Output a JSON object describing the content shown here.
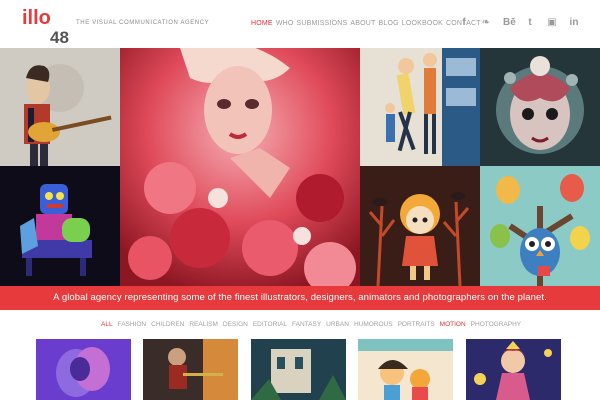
{
  "brand": {
    "logo_text": "illo",
    "logo_digits": "48",
    "tagline": "THE VISUAL COMMUNICATION AGENCY",
    "accent": "#e63a3d"
  },
  "nav": {
    "items": [
      {
        "label": "HOME",
        "active": true
      },
      {
        "label": "WHO",
        "active": false
      },
      {
        "label": "SUBMISSIONS",
        "active": false
      },
      {
        "label": "ABOUT",
        "active": false
      },
      {
        "label": "BLOG",
        "active": false
      },
      {
        "label": "LOOKBOOK",
        "active": false
      },
      {
        "label": "CONTACT",
        "active": false
      }
    ]
  },
  "social": {
    "icons": [
      {
        "name": "facebook-icon",
        "glyph": "f"
      },
      {
        "name": "twitter-icon",
        "glyph": "❧"
      },
      {
        "name": "behance-icon",
        "glyph": "Bē"
      },
      {
        "name": "tumblr-icon",
        "glyph": "t"
      },
      {
        "name": "instagram-icon",
        "glyph": "▣"
      },
      {
        "name": "linkedin-icon",
        "glyph": "in"
      }
    ]
  },
  "banner": {
    "text": "A global agency representing some of the finest illustrators, designers, animators and photographers on the planet."
  },
  "filters": {
    "items": [
      {
        "label": "ALL",
        "active": true
      },
      {
        "label": "FASHION",
        "active": false
      },
      {
        "label": "CHILDREN",
        "active": false
      },
      {
        "label": "REALISM",
        "active": false
      },
      {
        "label": "DESIGN",
        "active": false
      },
      {
        "label": "EDITORIAL",
        "active": false
      },
      {
        "label": "FANTASY",
        "active": false
      },
      {
        "label": "URBAN",
        "active": false
      },
      {
        "label": "HUMOROUS",
        "active": false
      },
      {
        "label": "PORTRAITS",
        "active": false
      },
      {
        "label": "MOTION",
        "active": true
      },
      {
        "label": "PHOTOGRAPHY",
        "active": false
      }
    ]
  }
}
